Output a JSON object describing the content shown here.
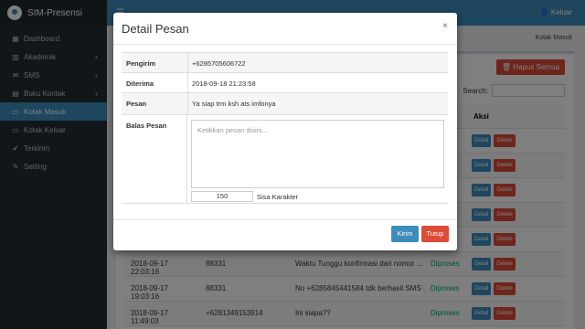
{
  "app": {
    "brand": "SIM-Presensi",
    "user": "Keluar"
  },
  "sidebar": {
    "items": [
      {
        "label": "Dashboard",
        "icon": "dashboard-icon",
        "glyph": "▦",
        "chevron": false
      },
      {
        "label": "Akademik",
        "icon": "institution-icon",
        "glyph": "▥",
        "chevron": true
      },
      {
        "label": "SMS",
        "icon": "envelope-icon",
        "glyph": "✉",
        "chevron": true
      },
      {
        "label": "Buku Kontak",
        "icon": "book-icon",
        "glyph": "▤",
        "chevron": true
      },
      {
        "label": "Kotak Masuk",
        "icon": "inbox-icon",
        "glyph": "▭",
        "chevron": false,
        "active": true
      },
      {
        "label": "Kotak Keluar",
        "icon": "outbox-icon",
        "glyph": "▭",
        "chevron": false
      },
      {
        "label": "Terkirim",
        "icon": "check-circle-icon",
        "glyph": "✔",
        "chevron": false
      },
      {
        "label": "Setting",
        "icon": "wrench-icon",
        "glyph": "✎",
        "chevron": false
      }
    ]
  },
  "page": {
    "breadcrumb": "Kotak Masuk",
    "hapus_semua": "Hapus Semua",
    "search_label": "Search:",
    "column_aksi": "Aksi",
    "rows": [
      {
        "date": "2018-09-17 22:03:16",
        "sender": "88331",
        "message": "Waktu Tunggu konfirmasi dari nomor ...",
        "status": "Diproses"
      },
      {
        "date": "2018-09-17 19:03:16",
        "sender": "88331",
        "message": "No +6285845441584 tdk berhasil SMS ...",
        "status": "Diproses"
      },
      {
        "date": "2018-09-17 11:49:03",
        "sender": "+6281349153914",
        "message": "Ini siapa??",
        "status": "Diproses"
      }
    ],
    "btn_detail": "Detail",
    "btn_delete": "Delete"
  },
  "modal": {
    "title": "Detail Pesan",
    "close": "×",
    "pengirim_label": "Pengirim",
    "pengirim_value": "+6285705606722",
    "diterima_label": "Diterima",
    "diterima_value": "2018-09-18 21:23:58",
    "pesan_label": "Pesan",
    "pesan_value": "Ya siap trm ksh ats imfonya",
    "balas_label": "Balas Pesan",
    "reply_placeholder": "Ketikkan pesan disini...",
    "char_count": "150",
    "char_label": "Sisa Karakter",
    "kirim": "Kirim",
    "tutup": "Tutup"
  },
  "colors": {
    "primary": "#3c8dbc",
    "danger": "#dd4b39",
    "sidebar": "#222d32",
    "success": "#00a65a"
  }
}
